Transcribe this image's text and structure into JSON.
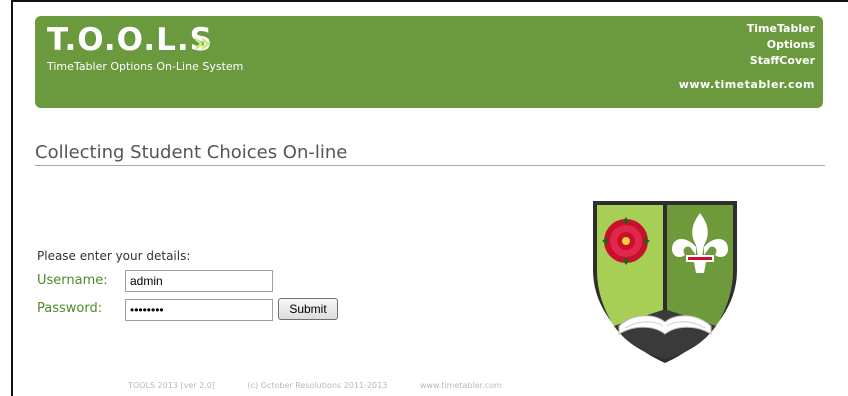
{
  "header": {
    "title": "T.O.O.L.S",
    "subtitle": "TimeTabler Options On-Line System",
    "nav": [
      "TimeTabler",
      "Options",
      "StaffCover"
    ],
    "site_url": "www.timetabler.com",
    "brand_color": "#6a9a3d",
    "chevron_icon": "double-chevron-right-icon"
  },
  "main": {
    "heading": "Collecting Student Choices On-line",
    "form": {
      "intro": "Please enter your details:",
      "username_label": "Username:",
      "username_value": "admin",
      "password_label": "Password:",
      "password_value": "********",
      "submit_label": "Submit"
    },
    "crest_icon": "school-crest-icon"
  },
  "footer": {
    "version": "TOOLS 2013 [ver 2.0]",
    "copyright": "(c) October Resolutions 2011-2013",
    "url": "www.timetabler.com"
  }
}
